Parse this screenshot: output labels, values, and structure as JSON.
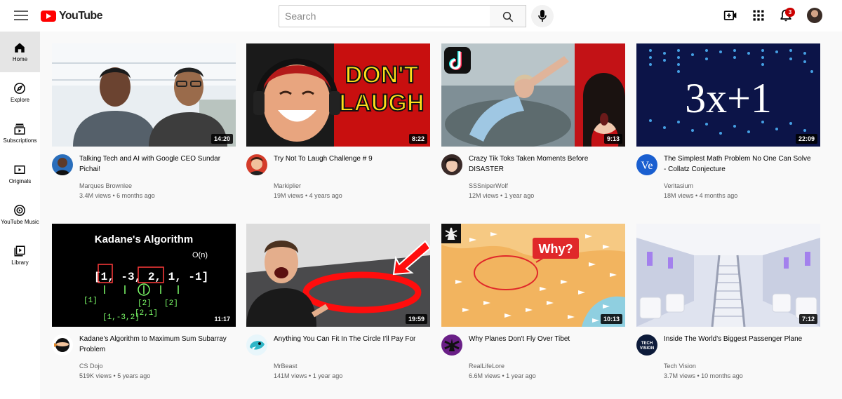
{
  "header": {
    "logo_text": "YouTube",
    "search_placeholder": "Search",
    "notification_count": "3"
  },
  "sidebar": {
    "items": [
      {
        "label": "Home",
        "icon": "home-icon"
      },
      {
        "label": "Explore",
        "icon": "compass-icon"
      },
      {
        "label": "Subscriptions",
        "icon": "subscriptions-icon"
      },
      {
        "label": "Originals",
        "icon": "originals-icon"
      },
      {
        "label": "YouTube Music",
        "icon": "music-icon"
      },
      {
        "label": "Library",
        "icon": "library-icon"
      }
    ]
  },
  "videos": [
    {
      "title": "Talking Tech and AI with Google CEO Sundar Pichai!",
      "channel": "Marques Brownlee",
      "views": "3.4M views",
      "age": "6 months ago",
      "duration": "14:20",
      "thumb_text": ""
    },
    {
      "title": "Try Not To Laugh Challenge # 9",
      "channel": "Markiplier",
      "views": "19M views",
      "age": "4 years ago",
      "duration": "8:22",
      "thumb_text": "DON'T LAUGH"
    },
    {
      "title": "Crazy Tik Toks Taken Moments Before DISASTER",
      "channel": "SSSniperWolf",
      "views": "12M views",
      "age": "1 year ago",
      "duration": "9:13",
      "thumb_text": ""
    },
    {
      "title": "The Simplest Math Problem No One Can Solve - Collatz Conjecture",
      "channel": "Veritasium",
      "views": "18M views",
      "age": "4 months ago",
      "duration": "22:09",
      "thumb_text": "3x+1"
    },
    {
      "title": "Kadane's Algorithm to Maximum Sum Subarray Problem",
      "channel": "CS Dojo",
      "views": "519K views",
      "age": "5 years ago",
      "duration": "11:17",
      "thumb_text": "Kadane's Algorithm"
    },
    {
      "title": "Anything You Can Fit In The Circle I'll Pay For",
      "channel": "MrBeast",
      "views": "141M views",
      "age": "1 year ago",
      "duration": "19:59",
      "thumb_text": ""
    },
    {
      "title": "Why Planes Don't Fly Over Tibet",
      "channel": "RealLifeLore",
      "views": "6.6M views",
      "age": "1 year ago",
      "duration": "10:13",
      "thumb_text": "Why?"
    },
    {
      "title": "Inside The World's Biggest Passenger Plane",
      "channel": "Tech Vision",
      "views": "3.7M views",
      "age": "10 months ago",
      "duration": "7:12",
      "thumb_text": ""
    }
  ],
  "colors": {
    "brand": "#ff0000",
    "text": "#030303",
    "secondary_text": "#606060",
    "background": "#f9f9f9"
  }
}
